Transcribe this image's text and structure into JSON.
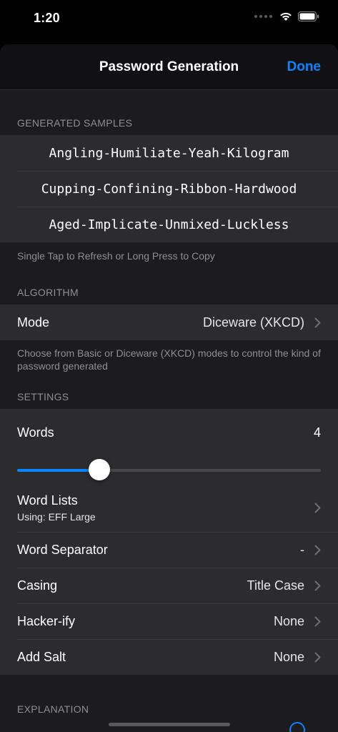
{
  "status": {
    "time": "1:20"
  },
  "nav": {
    "title": "Password Generation",
    "done_label": "Done"
  },
  "samples": {
    "header": "GENERATED SAMPLES",
    "items": [
      "Angling-Humiliate-Yeah-Kilogram",
      "Cupping-Confining-Ribbon-Hardwood",
      "Aged-Implicate-Unmixed-Luckless"
    ],
    "footer": "Single Tap to Refresh or Long Press to Copy"
  },
  "algorithm": {
    "header": "ALGORITHM",
    "mode_label": "Mode",
    "mode_value": "Diceware (XKCD)",
    "footer": "Choose from Basic or Diceware (XKCD) modes to control the kind of password generated"
  },
  "settings": {
    "header": "SETTINGS",
    "words_label": "Words",
    "words_value": "4",
    "slider_fraction": 0.27,
    "word_lists_label": "Word Lists",
    "word_lists_sub": "Using: EFF Large",
    "separator_label": "Word Separator",
    "separator_value": "-",
    "casing_label": "Casing",
    "casing_value": "Title Case",
    "hackerify_label": "Hacker-ify",
    "hackerify_value": "None",
    "salt_label": "Add Salt",
    "salt_value": "None"
  },
  "explanation": {
    "header": "EXPLANATION"
  },
  "colors": {
    "accent": "#0a84ff",
    "background": "#1c1c1e",
    "cell": "#2c2c2e"
  }
}
